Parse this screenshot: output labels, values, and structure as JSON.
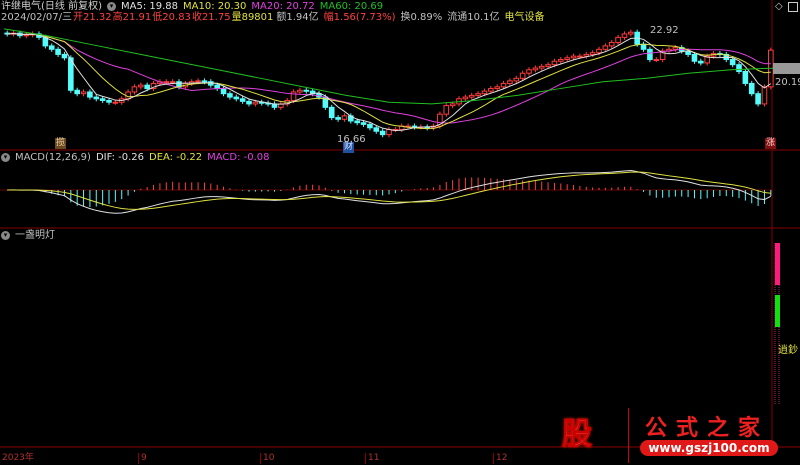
{
  "header": {
    "title": "许继电气(日线 前复权)",
    "ma5": "MA5: 19.88",
    "ma10": "MA10: 20.30",
    "ma20": "MA20: 20.72",
    "ma60": "MA60: 20.69",
    "date": "2024/02/07/三",
    "open": "开21.32",
    "high": "高21.91",
    "low": "低20.83",
    "close": "收21.75",
    "volume": "量89801",
    "amount": "额1.94亿",
    "change": "幅1.56(7.73%)",
    "turnover": "换0.89%",
    "float": "流通10.1亿",
    "sector": "电气设备"
  },
  "price_panel": {
    "high_label": "22.92",
    "low_label": "16.66",
    "right_label": "20.19",
    "tags": [
      "揽",
      "财",
      "涨"
    ]
  },
  "macd_panel": {
    "title": "MACD(12,26,9)",
    "dif": "DIF: -0.26",
    "dea": "DEA: -0.22",
    "macd": "MACD: -0.08"
  },
  "indicator_panel": {
    "title": "一盏明灯",
    "signal_label": "逍鈔"
  },
  "x_axis": [
    "2023年",
    "9",
    "10",
    "11",
    "12"
  ],
  "watermark": {
    "char": "股",
    "name": "公式之家",
    "url": "www.gszj100.com"
  },
  "colors": {
    "up": "#ff3c3c",
    "down": "#54fcfc",
    "ma5": "#e0e0e0",
    "ma10": "#e0e040",
    "ma20": "#e040e0",
    "ma60": "#20c020"
  },
  "chart_data": {
    "type": "candlestick",
    "price_range": [
      15.9,
      23.4
    ],
    "closes": [
      22.7,
      22.75,
      22.6,
      22.65,
      22.7,
      22.5,
      22.0,
      21.8,
      21.5,
      21.3,
      19.4,
      19.2,
      19.3,
      19.0,
      18.9,
      18.8,
      18.7,
      18.7,
      18.9,
      19.3,
      19.6,
      19.7,
      19.5,
      19.8,
      19.9,
      19.9,
      19.9,
      19.6,
      19.8,
      19.9,
      19.95,
      19.9,
      19.7,
      19.5,
      19.2,
      19.0,
      18.9,
      18.75,
      18.6,
      18.7,
      18.65,
      18.6,
      18.4,
      18.6,
      18.8,
      19.3,
      19.4,
      19.35,
      19.2,
      19.0,
      18.4,
      17.8,
      17.7,
      17.9,
      17.6,
      17.5,
      17.4,
      17.2,
      17.0,
      16.8,
      17.1,
      17.1,
      17.3,
      17.3,
      17.25,
      17.25,
      17.2,
      17.3,
      18.0,
      18.5,
      18.6,
      18.9,
      19.0,
      19.1,
      19.2,
      19.35,
      19.5,
      19.6,
      19.8,
      19.95,
      20.1,
      20.4,
      20.6,
      20.7,
      20.8,
      20.9,
      21.1,
      21.2,
      21.3,
      21.4,
      21.4,
      21.5,
      21.6,
      21.8,
      22.0,
      22.2,
      22.5,
      22.7,
      22.8,
      22.1,
      21.8,
      21.2,
      21.2,
      21.7,
      21.8,
      21.9,
      21.7,
      21.5,
      21.1,
      21.0,
      21.4,
      21.55,
      21.5,
      21.2,
      20.9,
      20.5,
      19.8,
      19.2,
      18.6,
      19.6,
      21.75
    ],
    "ma60": [
      23.0,
      22.6,
      22.1,
      21.6,
      21.1,
      20.6,
      20.1,
      19.6,
      19.1,
      18.7,
      18.6,
      18.8,
      19.1,
      19.5,
      19.9,
      20.1,
      20.4,
      20.6,
      20.7
    ]
  }
}
